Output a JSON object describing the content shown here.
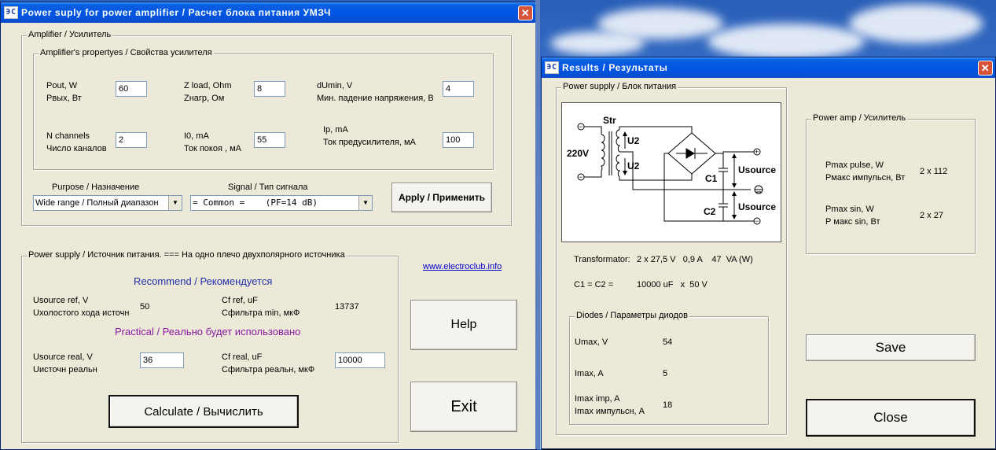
{
  "main_window": {
    "icon_text": "ЭС",
    "title": "Power suply for power amplifier / Расчет блока питания УМЗЧ",
    "close": "✕",
    "amplifier_group": {
      "legend": "Amplifier / Усилитель",
      "props_legend": "Amplifier's propertyes / Свойства усилителя",
      "pout_label_en": "Pout, W",
      "pout_label_ru": "Рвых, Вт",
      "pout_value": "60",
      "zload_label_en": "Z load, Ohm",
      "zload_label_ru": "Zнагр, Ом",
      "zload_value": "8",
      "dumin_label_en": "dUmin, V",
      "dumin_label_ru": "Мин. падение напряжения, В",
      "dumin_value": "4",
      "nch_label_en": "N channels",
      "nch_label_ru": "Число каналов",
      "nch_value": "2",
      "i0_label_en": "I0, mA",
      "i0_label_ru": "Ток покоя , мА",
      "i0_value": "55",
      "ip_label_en": "Ip, mA",
      "ip_label_ru": "Ток предусилителя, мА",
      "ip_value": "100",
      "purpose_label": "Purpose / Назначение",
      "purpose_value": "Wide range / Полный диапазон",
      "signal_label": "Signal / Тип сигнала",
      "signal_value": "= Common =    (PF=14 dB)",
      "apply_label": "Apply / Применить"
    },
    "power_group": {
      "legend": "Power supply / Источник питания. === На одно плечо двухполярного источника",
      "recommend": "Recommend / Рекомендуется",
      "usource_ref_en": "Usource ref, V",
      "usource_ref_ru": "Uхолостого хода источн",
      "usource_ref_value": "50",
      "cf_ref_en": "Cf ref, uF",
      "cf_ref_ru": "Сфильтра min, мкФ",
      "cf_ref_value": "13737",
      "practical": "Practical / Реально будет использовано",
      "usource_real_en": "Usource real, V",
      "usource_real_ru": "Uисточн реальн",
      "usource_real_value": "36",
      "cf_real_en": "Cf real, uF",
      "cf_real_ru": "Сфильтра реальн, мкФ",
      "cf_real_value": "10000",
      "calculate_label": "Calculate / Вычислить"
    },
    "link": "www.electroclub.info",
    "help_label": "Help",
    "exit_label": "Exit"
  },
  "results_window": {
    "icon_text": "ЭС",
    "title": "Results / Результаты",
    "close": "✕",
    "ps_legend": "Power supply / Блок питания",
    "schematic": {
      "str": "Str",
      "v220": "220V",
      "u2_top": "U2",
      "u2_bottom": "U2",
      "c1": "C1",
      "c2": "C2",
      "usource_top": "Usource",
      "usource_bottom": "Usource"
    },
    "transformator_label": "Transformator:",
    "transformator_value": "2 x 27,5 V   0,9 A    47  VA (W)",
    "c_label": "C1 = C2 =",
    "c_value": "10000 uF   x  50 V",
    "diodes_legend": "Diodes / Параметры диодов",
    "umax_label": "Umax, V",
    "umax_value": "54",
    "imax_label": "Imax, A",
    "imax_value": "5",
    "imax_imp_en": "Imax imp, A",
    "imax_imp_ru": "Imax импульсн, A",
    "imax_imp_value": "18",
    "amp_legend": "Power amp / Усилитель",
    "pmax_pulse_en": "Pmax pulse, W",
    "pmax_pulse_ru": "Pмакс импульсн, Вт",
    "pmax_pulse_value": "2 x 112",
    "pmax_sin_en": "Pmax sin, W",
    "pmax_sin_ru": "P макс sin, Вт",
    "pmax_sin_value": "2 x 27",
    "save_label": "Save",
    "close_label": "Close"
  }
}
